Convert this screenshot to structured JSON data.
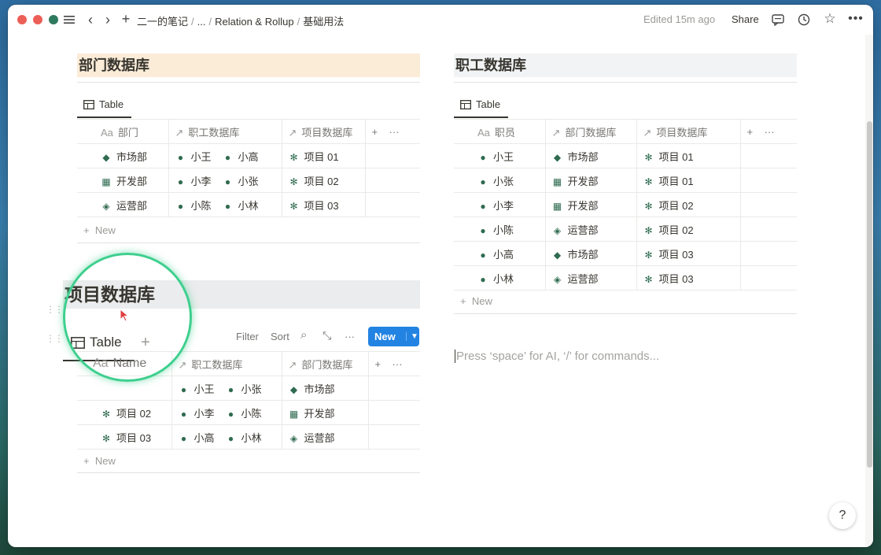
{
  "topbar": {
    "breadcrumbs": [
      "二一的笔记",
      "...",
      "Relation & Rollup",
      "基础用法"
    ],
    "edited": "Edited 15m ago",
    "share": "Share"
  },
  "dept_db": {
    "title": "部门数据库",
    "view": "Table",
    "columns": [
      "部门",
      "职工数据库",
      "项目数据库"
    ],
    "rows": [
      {
        "icon": "tag-icon",
        "name": "市场部",
        "staff": [
          "小王",
          "小高"
        ],
        "project": "项目 01"
      },
      {
        "icon": "grid-icon",
        "name": "开发部",
        "staff": [
          "小李",
          "小张"
        ],
        "project": "项目 02"
      },
      {
        "icon": "diamond-icon",
        "name": "运营部",
        "staff": [
          "小陈",
          "小林"
        ],
        "project": "项目 03"
      }
    ],
    "new_label": "New"
  },
  "staff_db": {
    "title": "职工数据库",
    "view": "Table",
    "columns": [
      "职员",
      "部门数据库",
      "项目数据库"
    ],
    "rows": [
      {
        "name": "小王",
        "dept_icon": "tag-icon",
        "dept": "市场部",
        "project": "项目 01"
      },
      {
        "name": "小张",
        "dept_icon": "grid-icon",
        "dept": "开发部",
        "project": "项目 01"
      },
      {
        "name": "小李",
        "dept_icon": "grid-icon",
        "dept": "开发部",
        "project": "项目 02"
      },
      {
        "name": "小陈",
        "dept_icon": "diamond-icon",
        "dept": "运营部",
        "project": "项目 02"
      },
      {
        "name": "小高",
        "dept_icon": "tag-icon",
        "dept": "市场部",
        "project": "项目 03"
      },
      {
        "name": "小林",
        "dept_icon": "diamond-icon",
        "dept": "运营部",
        "project": "项目 03"
      }
    ],
    "new_label": "New"
  },
  "project_db": {
    "title": "项目数据库",
    "view": "Table",
    "toolbar": {
      "filter": "Filter",
      "sort": "Sort",
      "new": "New"
    },
    "columns": [
      "Name",
      "职工数据库",
      "部门数据库"
    ],
    "rows": [
      {
        "name": "",
        "staff": [
          "小王",
          "小张"
        ],
        "dept_icon": "tag-icon",
        "dept": "市场部"
      },
      {
        "name": "项目 02",
        "staff": [
          "小李",
          "小陈"
        ],
        "dept_icon": "grid-icon",
        "dept": "开发部"
      },
      {
        "name": "项目 03",
        "staff": [
          "小高",
          "小林"
        ],
        "dept_icon": "diamond-icon",
        "dept": "运营部"
      }
    ],
    "new_label": "New"
  },
  "editor": {
    "placeholder": "Press ‘space’ for AI, ‘/’ for commands..."
  },
  "help": "?"
}
